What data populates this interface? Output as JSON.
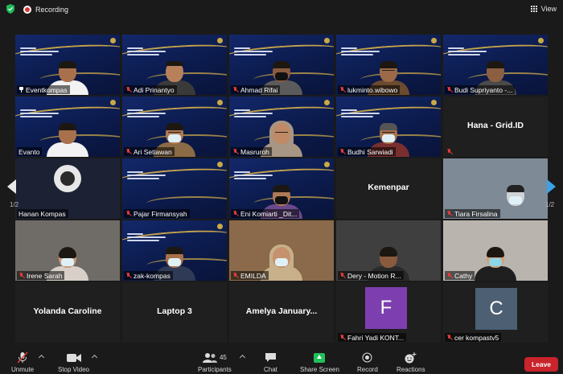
{
  "topbar": {
    "recording": "Recording",
    "view": "View"
  },
  "pages": {
    "left": "1/2",
    "right": "1/2"
  },
  "tiles": [
    {
      "name": "Eventkompas"
    },
    {
      "name": "Adi Prinantyo"
    },
    {
      "name": "Ahmad Rifai"
    },
    {
      "name": "lukminto.wibowo"
    },
    {
      "name": "Budi Supriyanto -..."
    },
    {
      "name": "Evanto"
    },
    {
      "name": "Ari Setiawan"
    },
    {
      "name": "Masruroh"
    },
    {
      "name": "Budhi Sarwiadi"
    },
    {
      "name": "",
      "center": "Hana - Grid.ID"
    },
    {
      "name": "Hanan Kompas"
    },
    {
      "name": "Pajar Firmansyah"
    },
    {
      "name": "Eni Komiarti _Dit..."
    },
    {
      "name": "",
      "center": "Kemenpar"
    },
    {
      "name": "Tiara Firsalina"
    },
    {
      "name": "Irene Sarah"
    },
    {
      "name": "zak-kompas"
    },
    {
      "name": "EMILDA"
    },
    {
      "name": "Dery - Motion R..."
    },
    {
      "name": "Cathy"
    },
    {
      "name": "",
      "center": "Yolanda Caroline"
    },
    {
      "name": "",
      "center": "Laptop 3"
    },
    {
      "name": "",
      "center": "Amelya  January..."
    },
    {
      "name": "Fahri Yadi KONT...",
      "avatar": "F"
    },
    {
      "name": "cer kompastv5",
      "avatar": "C"
    }
  ],
  "toolbar": {
    "unmute": "Unmute",
    "stop_video": "Stop Video",
    "participants": "Participants",
    "participants_count": "45",
    "chat": "Chat",
    "share_screen": "Share Screen",
    "record": "Record",
    "reactions": "Reactions",
    "leave": "Leave"
  },
  "colors": {
    "active_border": "#d6e64b",
    "share": "#20c05a",
    "leave": "#c9232b",
    "avatar_f": "#7d3fb0",
    "avatar_c": "#4c5f73"
  }
}
